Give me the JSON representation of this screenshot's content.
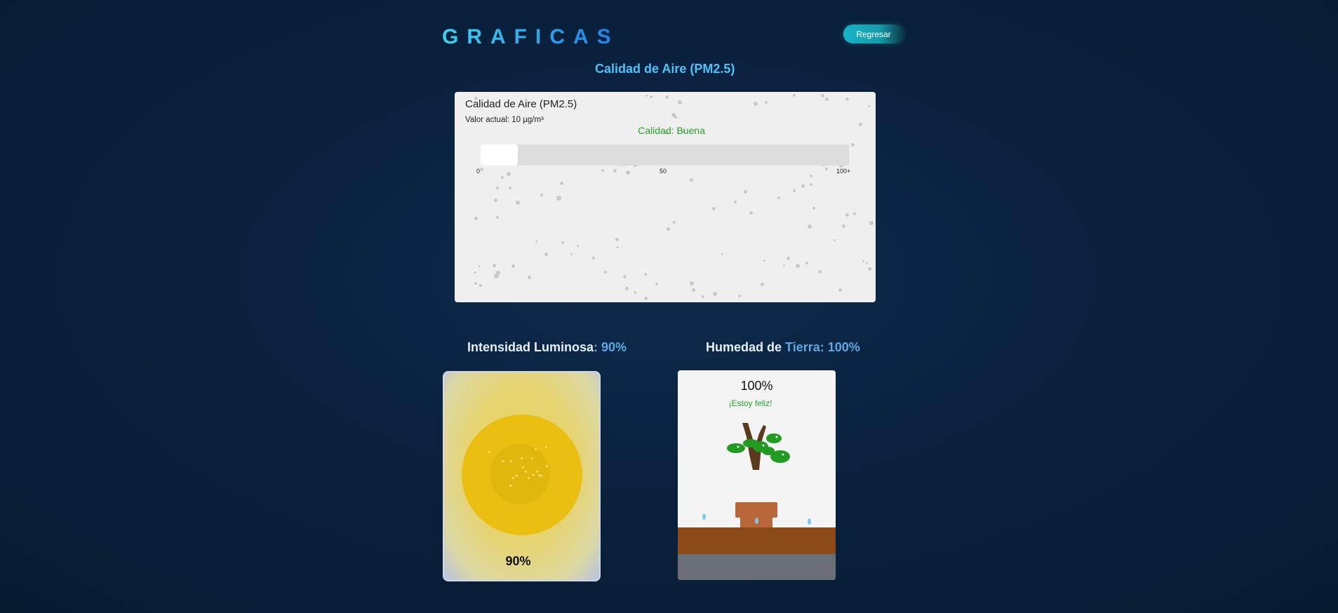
{
  "page": {
    "title": "GRAFICAS",
    "back_label": "Regresar"
  },
  "air": {
    "section_title": "Calidad de Aire (PM2.5)",
    "card_title": "Calidad de Aire (PM2.5)",
    "current_value": "Valor actual: 10 µg/m³",
    "quality": "Calidad: Buena",
    "level_fraction": 0.1,
    "ticks": [
      "0",
      "50",
      "100+"
    ]
  },
  "light": {
    "label_prefix": "Intensidad ",
    "label_word": "Luminosa",
    "label_suffix": ": 90%",
    "value_text": "90%",
    "level_fraction": 0.9
  },
  "soil": {
    "label_prefix": "Humedad ",
    "label_mid": "de ",
    "label_word": "Tierra",
    "label_suffix": ": 100%",
    "value_text": "100%",
    "message": "¡Estoy feliz!",
    "level_fraction": 1.0
  },
  "colors": {
    "accent": "#4fc3f7",
    "good": "#23a32a",
    "sun": "#ebbf12",
    "soil": "#8b4a17"
  }
}
